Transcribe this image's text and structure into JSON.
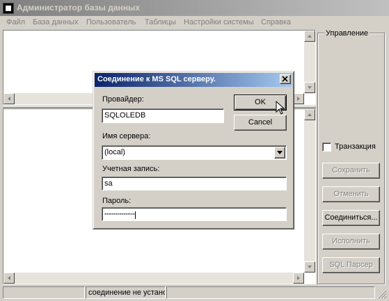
{
  "window": {
    "title": "Администратор базы данных"
  },
  "menu": {
    "items": [
      "Файл",
      "База данных",
      "Пользователь",
      "Таблицы",
      "Настройки системы",
      "Справка"
    ]
  },
  "control_panel": {
    "title": "Управление",
    "transaction_label": "Транзакция",
    "transaction_checked": false,
    "buttons": {
      "save": "Сохранить",
      "cancel": "Отменить",
      "connect": "Соединиться...",
      "execute": "Исполнить",
      "sql_parser": "SQL Парсер"
    }
  },
  "dialog": {
    "title": "Соединение к MS SQL серверу.",
    "ok_label": "OK",
    "cancel_label": "Cancel",
    "provider_label": "Провайдер:",
    "provider_value": "SQLOLEDB",
    "server_label": "Имя сервера:",
    "server_value": "(local)",
    "account_label": "Учетная запись:",
    "account_value": "sa",
    "password_label": "Пароль:",
    "password_value": "****************"
  },
  "statusbar": {
    "panes": [
      "",
      "соединение не устано",
      ""
    ]
  },
  "colors": {
    "face": "#d4d0c8",
    "dialog_title_start": "#0a246a",
    "dialog_title_end": "#a6caf0",
    "inactive_title_start": "#808080"
  }
}
